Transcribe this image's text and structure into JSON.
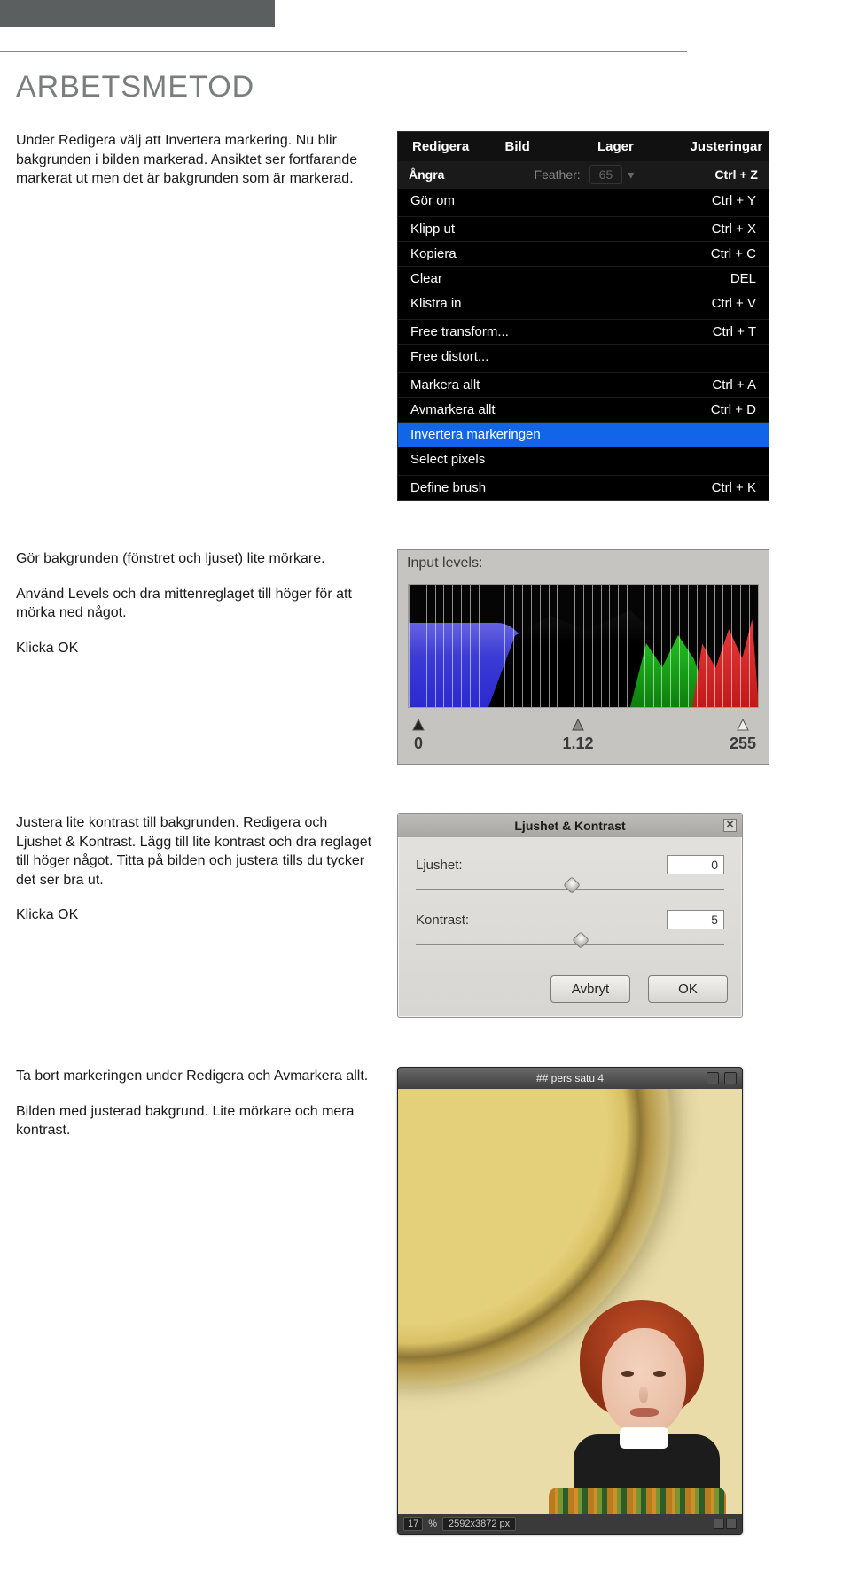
{
  "page": {
    "heading": "ARBETSMETOD"
  },
  "steps": {
    "s1": {
      "p1": "Under Redigera välj att Invertera markering. Nu blir bakgrunden i bilden markerad. Ansiktet ser fortfarande markerat ut men det är bakgrunden som är markerad."
    },
    "s2": {
      "p1": "Gör bakgrunden (fönstret och ljuset) lite mörkare.",
      "p2": "Använd Levels och dra mittenreglaget till höger för att mörka ned något.",
      "p3": "Klicka OK"
    },
    "s3": {
      "p1": "Justera lite kontrast till bakgrunden. Redigera och Ljushet & Kontrast. Lägg till lite kontrast och dra reglaget till höger något. Titta på bilden och justera tills du tycker det ser bra ut.",
      "p2": "Klicka OK"
    },
    "s4": {
      "p1": "Ta bort markeringen under Redigera och Avmarkera allt.",
      "p2": "Bilden med justerad bakgrund. Lite mörkare och mera kontrast."
    }
  },
  "menu": {
    "header": {
      "c1": "Redigera",
      "c2": "Bild",
      "c3": "Lager",
      "c4": "Justeringar"
    },
    "feather": {
      "label": "Feather:",
      "value": "65"
    },
    "items": [
      {
        "label": "Ångra",
        "kb": "Ctrl + Z"
      },
      {
        "label": "Gör om",
        "kb": "Ctrl + Y"
      },
      {
        "sep": true
      },
      {
        "label": "Klipp ut",
        "kb": "Ctrl + X"
      },
      {
        "label": "Kopiera",
        "kb": "Ctrl + C"
      },
      {
        "label": "Clear",
        "kb": "DEL"
      },
      {
        "label": "Klistra in",
        "kb": "Ctrl + V"
      },
      {
        "sep": true
      },
      {
        "label": "Free transform...",
        "kb": "Ctrl + T"
      },
      {
        "label": "Free distort...",
        "kb": ""
      },
      {
        "sep": true
      },
      {
        "label": "Markera allt",
        "kb": "Ctrl + A"
      },
      {
        "label": "Avmarkera allt",
        "kb": "Ctrl + D"
      },
      {
        "label": "Invertera markeringen",
        "kb": "",
        "highlight": true
      },
      {
        "label": "Select pixels",
        "kb": ""
      },
      {
        "sep": true
      },
      {
        "label": "Define brush",
        "kb": "Ctrl + K"
      }
    ]
  },
  "histogram": {
    "label": "Input levels:",
    "axis": {
      "min": "0",
      "mid": "1.12",
      "max": "255"
    }
  },
  "dialog": {
    "title": "Ljushet & Kontrast",
    "ljushet_label": "Ljushet:",
    "ljushet_value": "0",
    "kontrast_label": "Kontrast:",
    "kontrast_value": "5",
    "cancel": "Avbryt",
    "ok": "OK"
  },
  "photo": {
    "title": "## pers satu 4",
    "zoom": "17",
    "zoom_unit": "%",
    "dimensions": "2592x3872 px"
  }
}
